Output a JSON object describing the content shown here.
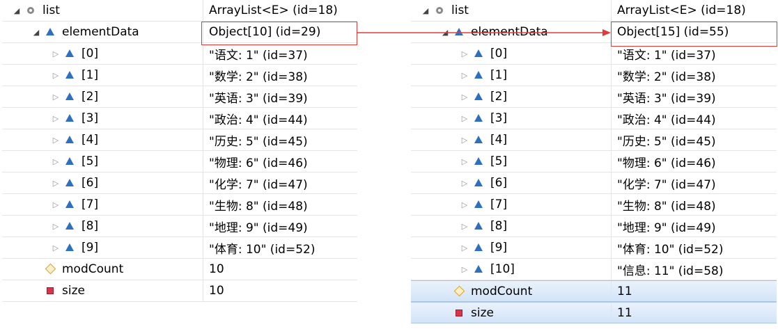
{
  "left": {
    "rows": [
      {
        "name": "list",
        "value": "ArrayList<E>  (id=18)",
        "icon": "field-icon",
        "expander": "expanded",
        "depth": 0
      },
      {
        "name": "elementData",
        "value": "Object[10]  (id=29)",
        "icon": "protected-field-icon",
        "expander": "expanded",
        "depth": 1
      },
      {
        "name": "[0]",
        "value": "\"语文: 1\" (id=37)",
        "icon": "protected-field-icon",
        "expander": "collapsed",
        "depth": 2
      },
      {
        "name": "[1]",
        "value": "\"数学: 2\" (id=38)",
        "icon": "protected-field-icon",
        "expander": "collapsed",
        "depth": 2
      },
      {
        "name": "[2]",
        "value": "\"英语: 3\" (id=39)",
        "icon": "protected-field-icon",
        "expander": "collapsed",
        "depth": 2
      },
      {
        "name": "[3]",
        "value": "\"政治: 4\" (id=44)",
        "icon": "protected-field-icon",
        "expander": "collapsed",
        "depth": 2
      },
      {
        "name": "[4]",
        "value": "\"历史: 5\" (id=45)",
        "icon": "protected-field-icon",
        "expander": "collapsed",
        "depth": 2
      },
      {
        "name": "[5]",
        "value": "\"物理: 6\" (id=46)",
        "icon": "protected-field-icon",
        "expander": "collapsed",
        "depth": 2
      },
      {
        "name": "[6]",
        "value": "\"化学: 7\" (id=47)",
        "icon": "protected-field-icon",
        "expander": "collapsed",
        "depth": 2
      },
      {
        "name": "[7]",
        "value": "\"生物: 8\" (id=48)",
        "icon": "protected-field-icon",
        "expander": "collapsed",
        "depth": 2
      },
      {
        "name": "[8]",
        "value": "\"地理: 9\" (id=49)",
        "icon": "protected-field-icon",
        "expander": "collapsed",
        "depth": 2
      },
      {
        "name": "[9]",
        "value": "\"体育: 10\" (id=52)",
        "icon": "protected-field-icon",
        "expander": "collapsed",
        "depth": 2
      },
      {
        "name": "modCount",
        "value": "10",
        "icon": "package-field-icon",
        "expander": "none",
        "depth": 1
      },
      {
        "name": "size",
        "value": "10",
        "icon": "private-field-icon",
        "expander": "none",
        "depth": 1
      }
    ]
  },
  "right": {
    "rows": [
      {
        "name": "list",
        "value": "ArrayList<E>  (id=18)",
        "icon": "field-icon",
        "expander": "expanded",
        "depth": 0
      },
      {
        "name": "elementData",
        "value": "Object[15]  (id=55)",
        "icon": "protected-field-icon",
        "expander": "expanded",
        "depth": 1
      },
      {
        "name": "[0]",
        "value": "\"语文: 1\" (id=37)",
        "icon": "protected-field-icon",
        "expander": "collapsed",
        "depth": 2
      },
      {
        "name": "[1]",
        "value": "\"数学: 2\" (id=38)",
        "icon": "protected-field-icon",
        "expander": "collapsed",
        "depth": 2
      },
      {
        "name": "[2]",
        "value": "\"英语: 3\" (id=39)",
        "icon": "protected-field-icon",
        "expander": "collapsed",
        "depth": 2
      },
      {
        "name": "[3]",
        "value": "\"政治: 4\" (id=44)",
        "icon": "protected-field-icon",
        "expander": "collapsed",
        "depth": 2
      },
      {
        "name": "[4]",
        "value": "\"历史: 5\" (id=45)",
        "icon": "protected-field-icon",
        "expander": "collapsed",
        "depth": 2
      },
      {
        "name": "[5]",
        "value": "\"物理: 6\" (id=46)",
        "icon": "protected-field-icon",
        "expander": "collapsed",
        "depth": 2
      },
      {
        "name": "[6]",
        "value": "\"化学: 7\" (id=47)",
        "icon": "protected-field-icon",
        "expander": "collapsed",
        "depth": 2
      },
      {
        "name": "[7]",
        "value": "\"生物: 8\" (id=48)",
        "icon": "protected-field-icon",
        "expander": "collapsed",
        "depth": 2
      },
      {
        "name": "[8]",
        "value": "\"地理: 9\" (id=49)",
        "icon": "protected-field-icon",
        "expander": "collapsed",
        "depth": 2
      },
      {
        "name": "[9]",
        "value": "\"体育: 10\" (id=52)",
        "icon": "protected-field-icon",
        "expander": "collapsed",
        "depth": 2
      },
      {
        "name": "[10]",
        "value": "\"信息: 11\" (id=58)",
        "icon": "protected-field-icon",
        "expander": "collapsed",
        "depth": 2
      },
      {
        "name": "modCount",
        "value": "11",
        "icon": "package-field-icon",
        "expander": "none",
        "depth": 1,
        "selected": true
      },
      {
        "name": "size",
        "value": "11",
        "icon": "private-field-icon",
        "expander": "none",
        "depth": 1,
        "selected": true
      }
    ]
  },
  "colors": {
    "highlight": "#e23a3a",
    "selection": "#d3e4f8",
    "protected": "#2f6fc0"
  }
}
